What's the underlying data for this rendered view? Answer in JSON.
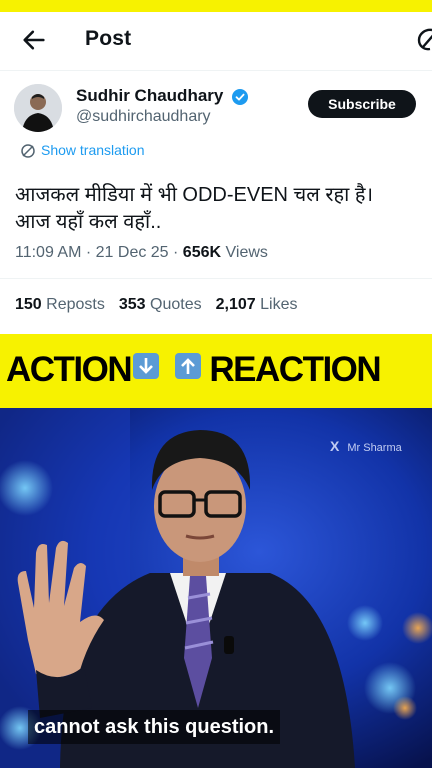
{
  "header": {
    "title": "Post"
  },
  "author": {
    "name": "Sudhir Chaudhary",
    "handle": "@sudhirchaudhary",
    "subscribe_label": "Subscribe"
  },
  "translate_label": "Show translation",
  "tweet": {
    "line1": "आजकल मीडिया में भी ODD-EVEN चल रहा है।",
    "line2": "आज यहाँ कल वहाँ.."
  },
  "meta": {
    "time": "11:09 AM",
    "date": "21 Dec 25",
    "views_count": "656K",
    "views_label": "Views"
  },
  "stats": {
    "reposts_count": "150",
    "reposts_label": "Reposts",
    "quotes_count": "353",
    "quotes_label": "Quotes",
    "likes_count": "2,107",
    "likes_label": "Likes"
  },
  "banner": {
    "left": "ACTION",
    "right": "REACTION"
  },
  "video": {
    "watermark_x": "X",
    "watermark_name": "Mr Sharma",
    "caption": "cannot ask this question."
  },
  "colors": {
    "banner_bg": "#f7f200",
    "link": "#1d9bf0",
    "verified": "#1d9bf0",
    "arrow_box": "#5b9bd5"
  }
}
